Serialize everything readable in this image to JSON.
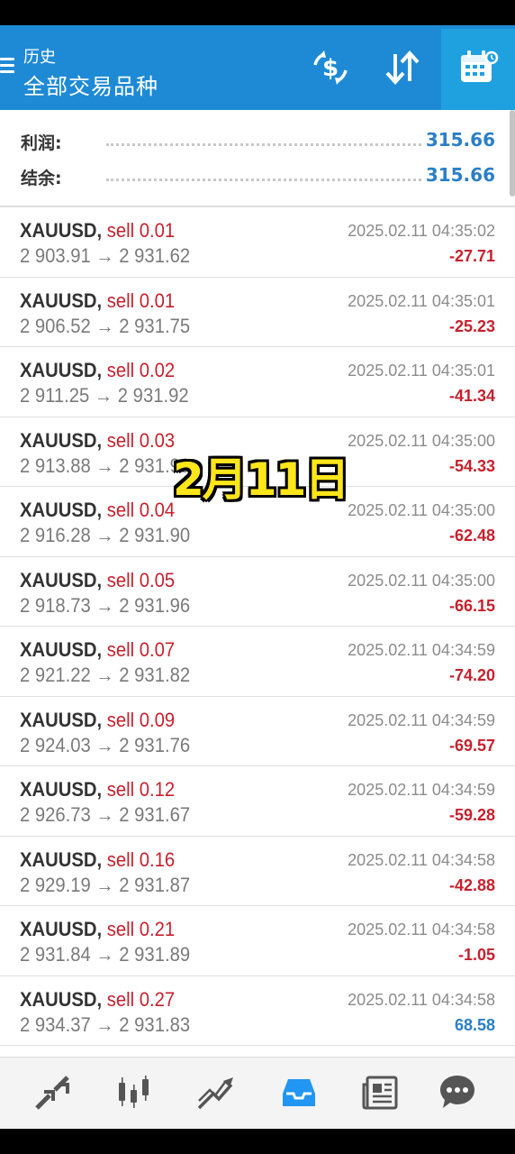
{
  "header": {
    "subtitle": "历史",
    "title": "全部交易品种",
    "icons": [
      "menu-icon",
      "deposit-withdraw-icon",
      "sort-icon",
      "calendar-icon"
    ]
  },
  "summary": {
    "profit_label": "利润:",
    "profit_value": "315.66",
    "balance_label": "结余:",
    "balance_value": "315.66"
  },
  "overlay_caption": "2月11日",
  "deals": [
    {
      "symbol": "XAUUSD,",
      "type": "sell 0.01",
      "open": "2 903.91",
      "close": "2 931.62",
      "time": "2025.02.11 04:35:02",
      "profit": "-27.71"
    },
    {
      "symbol": "XAUUSD,",
      "type": "sell 0.01",
      "open": "2 906.52",
      "close": "2 931.75",
      "time": "2025.02.11 04:35:01",
      "profit": "-25.23"
    },
    {
      "symbol": "XAUUSD,",
      "type": "sell 0.02",
      "open": "2 911.25",
      "close": "2 931.92",
      "time": "2025.02.11 04:35:01",
      "profit": "-41.34"
    },
    {
      "symbol": "XAUUSD,",
      "type": "sell 0.03",
      "open": "2 913.88",
      "close": "2 931.99",
      "time": "2025.02.11 04:35:00",
      "profit": "-54.33"
    },
    {
      "symbol": "XAUUSD,",
      "type": "sell 0.04",
      "open": "2 916.28",
      "close": "2 931.90",
      "time": "2025.02.11 04:35:00",
      "profit": "-62.48"
    },
    {
      "symbol": "XAUUSD,",
      "type": "sell 0.05",
      "open": "2 918.73",
      "close": "2 931.96",
      "time": "2025.02.11 04:35:00",
      "profit": "-66.15"
    },
    {
      "symbol": "XAUUSD,",
      "type": "sell 0.07",
      "open": "2 921.22",
      "close": "2 931.82",
      "time": "2025.02.11 04:34:59",
      "profit": "-74.20"
    },
    {
      "symbol": "XAUUSD,",
      "type": "sell 0.09",
      "open": "2 924.03",
      "close": "2 931.76",
      "time": "2025.02.11 04:34:59",
      "profit": "-69.57"
    },
    {
      "symbol": "XAUUSD,",
      "type": "sell 0.12",
      "open": "2 926.73",
      "close": "2 931.67",
      "time": "2025.02.11 04:34:59",
      "profit": "-59.28"
    },
    {
      "symbol": "XAUUSD,",
      "type": "sell 0.16",
      "open": "2 929.19",
      "close": "2 931.87",
      "time": "2025.02.11 04:34:58",
      "profit": "-42.88"
    },
    {
      "symbol": "XAUUSD,",
      "type": "sell 0.21",
      "open": "2 931.84",
      "close": "2 931.89",
      "time": "2025.02.11 04:34:58",
      "profit": "-1.05"
    },
    {
      "symbol": "XAUUSD,",
      "type": "sell 0.27",
      "open": "2 934.37",
      "close": "2 931.83",
      "time": "2025.02.11 04:34:58",
      "profit": "68.58"
    }
  ],
  "arrow": "→",
  "nav": {
    "items": [
      "quotes-icon",
      "chart-icon",
      "trade-icon",
      "history-icon",
      "news-icon",
      "chat-icon"
    ],
    "active": "history-icon"
  },
  "colors": {
    "header": "#1e8ad6",
    "active_tab": "#1fa0df",
    "loss": "#c8202d",
    "gain": "#2a7fc8",
    "nav_icon": "#555555",
    "nav_active": "#2196f3"
  }
}
